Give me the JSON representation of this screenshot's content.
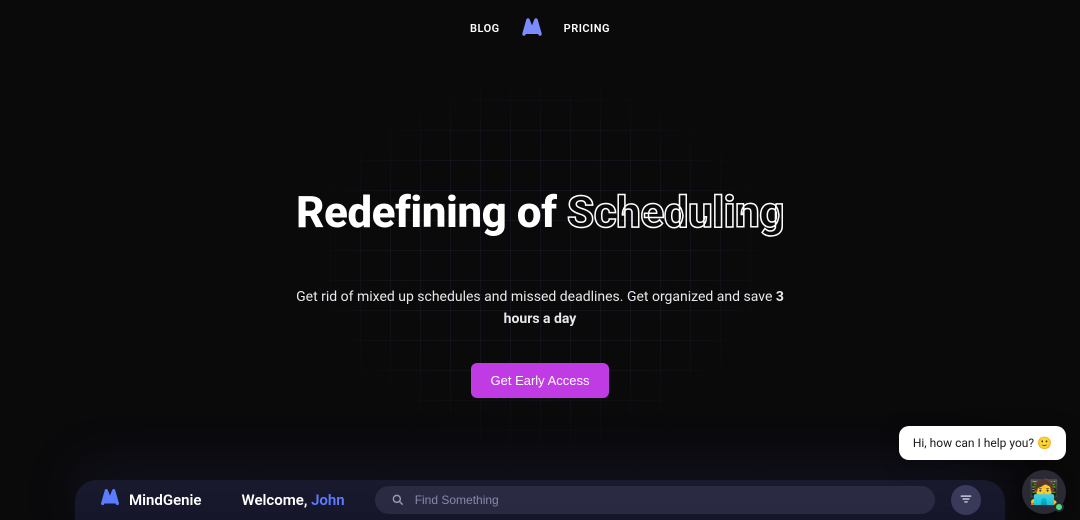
{
  "nav": {
    "blog": "BLOG",
    "pricing": "PRICING"
  },
  "hero": {
    "headline_prefix": "Redefining of ",
    "headline_outline": "Scheduling",
    "subhead_before": "Get rid of mixed up schedules and missed deadlines. Get organized and save ",
    "subhead_bold": "3 hours a day",
    "cta": "Get Early Access"
  },
  "app": {
    "brand": "MindGenie",
    "welcome_text": "Welcome, ",
    "welcome_name": "John",
    "search_placeholder": "Find Something"
  },
  "chat": {
    "message": "Hi, how can I help you? 🙂",
    "avatar_emoji": "🧑‍💻"
  },
  "colors": {
    "accent_purple": "#c13be5",
    "accent_blue": "#5b7cff",
    "status_green": "#4ade80"
  }
}
